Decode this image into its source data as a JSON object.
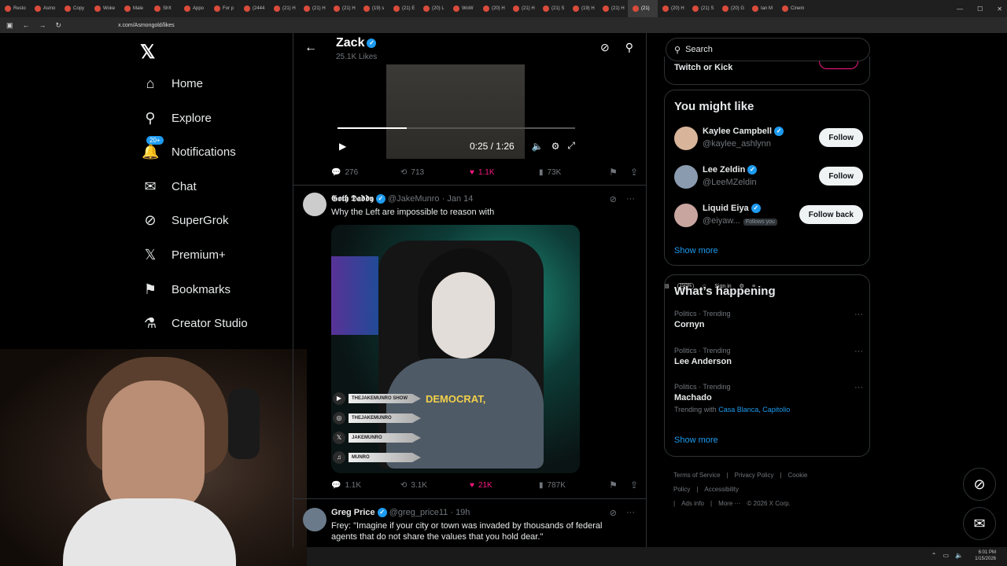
{
  "browser": {
    "tabs": [
      {
        "label": "Resto"
      },
      {
        "label": "Asmo"
      },
      {
        "label": "Copy"
      },
      {
        "label": "Woke"
      },
      {
        "label": "Male"
      },
      {
        "label": "Sh!t"
      },
      {
        "label": "Appo"
      },
      {
        "label": "For p"
      },
      {
        "label": "(2444"
      },
      {
        "label": "(21) H"
      },
      {
        "label": "(21) H"
      },
      {
        "label": "(21) H"
      },
      {
        "label": "(19) s"
      },
      {
        "label": "(21) E"
      },
      {
        "label": "(20) L"
      },
      {
        "label": "WoW"
      },
      {
        "label": "(20) H"
      },
      {
        "label": "(21) H"
      },
      {
        "label": "(21) S"
      },
      {
        "label": "(19) H"
      },
      {
        "label": "(21) H"
      },
      {
        "label": "(21)"
      },
      {
        "label": "(20) H"
      },
      {
        "label": "(21) S"
      },
      {
        "label": "(20) G"
      },
      {
        "label": "Ian M"
      },
      {
        "label": "Cinem"
      }
    ],
    "url": "x.com/Asmongold/likes",
    "zoom": "150%",
    "sign_in": "Sign in"
  },
  "nav": {
    "items": [
      {
        "label": "Home",
        "icon": "home-icon",
        "glyph": "⌂"
      },
      {
        "label": "Explore",
        "icon": "search-icon",
        "glyph": "⚲"
      },
      {
        "label": "Notifications",
        "icon": "bell-icon",
        "glyph": "🔔",
        "badge": "20+"
      },
      {
        "label": "Chat",
        "icon": "mail-icon",
        "glyph": "✉"
      },
      {
        "label": "SuperGrok",
        "icon": "grok-icon",
        "glyph": "⊘"
      },
      {
        "label": "Premium+",
        "icon": "x-logo-icon",
        "glyph": "𝕏"
      },
      {
        "label": "Bookmarks",
        "icon": "bookmark-icon",
        "glyph": "⚑"
      },
      {
        "label": "Creator Studio",
        "icon": "creator-studio-icon",
        "glyph": "⚗"
      }
    ]
  },
  "header": {
    "name": "Zack",
    "likes": "25.1K Likes"
  },
  "video_tweet": {
    "time": "0:25 / 1:26",
    "progress": 0.29,
    "replies": "276",
    "reposts": "713",
    "likes": "1.1K",
    "views": "73K"
  },
  "tweet2": {
    "name": "𝕲𝖔𝖙𝖍 𝕯𝖆𝖉𝖉𝖞",
    "handle": "@JakeMunro",
    "date": "Jan 14",
    "text": "Why the Left are impossible to reason with",
    "caption": "DEMOCRAT,",
    "social": [
      "THEJAKEMUNRO SHOW",
      "THEJAKEMUNRO",
      "JAKEMUNRO",
      "MUNRO"
    ],
    "replies": "1.1K",
    "reposts": "3.1K",
    "likes": "21K",
    "views": "787K"
  },
  "tweet3": {
    "name": "Greg Price",
    "handle": "@greg_price11",
    "date": "19h",
    "text": "Frey: \"Imagine if your city or town was invaded by thousands of federal agents that do not share the values that you hold dear.\""
  },
  "right": {
    "search_placeholder": "Search",
    "twitch_text": "Twitch or Kick",
    "might_like": {
      "title": "You might like",
      "people": [
        {
          "name": "Kaylee Campbell",
          "handle": "@kaylee_ashlynn",
          "button": "Follow",
          "follows_you": ""
        },
        {
          "name": "Lee Zeldin",
          "handle": "@LeeMZeldin",
          "button": "Follow",
          "follows_you": ""
        },
        {
          "name": "Liquid Eiya",
          "handle": "@eiyaw...",
          "button": "Follow back",
          "follows_you": "Follows you"
        }
      ],
      "show_more": "Show more"
    },
    "happening": {
      "title": "What’s happening",
      "trends": [
        {
          "category": "Politics · Trending",
          "name": "Cornyn",
          "with": "",
          "with_links": ""
        },
        {
          "category": "Politics · Trending",
          "name": "Lee Anderson",
          "with": "",
          "with_links": ""
        },
        {
          "category": "Politics · Trending",
          "name": "Machado",
          "with": "Trending with",
          "with_links": "Casa Blanca, Capitolio"
        }
      ],
      "show_more": "Show more"
    },
    "footer": [
      "Terms of Service",
      "|",
      "Privacy Policy",
      "|",
      "Cookie Policy",
      "|",
      "Accessibility",
      "|",
      "Ads info",
      "|",
      "More ···",
      "© 2026 X Corp."
    ]
  },
  "taskbar": {
    "time": "6:01 PM",
    "date": "1/15/2026"
  }
}
